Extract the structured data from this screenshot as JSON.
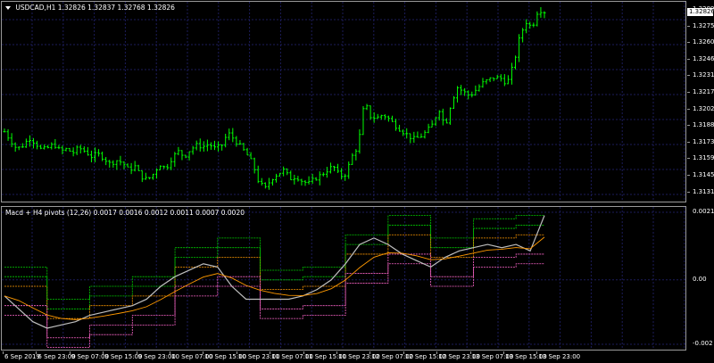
{
  "main_chart": {
    "title": "USDCAD,H1  1.32826 1.32837 1.32768 1.32826",
    "current_price": "1.32826",
    "price_labels": [
      "1.32895",
      "1.32750",
      "1.32605",
      "1.32460",
      "1.32315",
      "1.32170",
      "1.32025",
      "1.31880",
      "1.31735",
      "1.31590",
      "1.31450",
      "1.31310"
    ]
  },
  "indicator": {
    "title": "Macd + H4 pivots (12,26) 0.0017 0.0016 0.0012 0.0011 0.0007 0.0020",
    "scale_labels": [
      "0.0021",
      "0.00",
      "-0.002"
    ]
  },
  "time_axis": {
    "labels": [
      "6 Sep 2019",
      "6 Sep 23:00",
      "9 Sep 07:00",
      "9 Sep 15:00",
      "9 Sep 23:00",
      "10 Sep 07:00",
      "10 Sep 15:00",
      "10 Sep 23:00",
      "11 Sep 07:00",
      "11 Sep 15:00",
      "11 Sep 23:00",
      "12 Sep 07:00",
      "12 Sep 15:00",
      "12 Sep 23:00",
      "13 Sep 07:00",
      "13 Sep 15:00",
      "13 Sep 23:00"
    ]
  },
  "colors": {
    "background": "#000000",
    "candle": "#00ff00",
    "grid": "#1c1c5a",
    "macd_line": "#bebebe",
    "pivot_green": "#00cc00",
    "pivot_pink": "#ff66cc",
    "pivot_orange": "#ff9900",
    "pivot_white": "#ffffff"
  },
  "chart_data": {
    "type": "candlestick",
    "close_series": [
      1.3186,
      1.3179,
      1.3172,
      1.3175,
      1.3181,
      1.3177,
      1.3171,
      1.3173,
      1.3176,
      1.317,
      1.3172,
      1.3169,
      1.3173,
      1.317,
      1.3166,
      1.3168,
      1.3165,
      1.316,
      1.3163,
      1.3161,
      1.3155,
      1.3158,
      1.315,
      1.3147,
      1.3152,
      1.316,
      1.3156,
      1.3165,
      1.317,
      1.3166,
      1.3172,
      1.3175,
      1.3174,
      1.3176,
      1.3172,
      1.3175,
      1.3185,
      1.318,
      1.3174,
      1.3168,
      1.316,
      1.3145,
      1.314,
      1.3148,
      1.3152,
      1.3155,
      1.3148,
      1.315,
      1.3146,
      1.3144,
      1.3148,
      1.3151,
      1.3155,
      1.3158,
      1.315,
      1.3152,
      1.3166,
      1.3175,
      1.321,
      1.3198,
      1.3197,
      1.32,
      1.3196,
      1.3191,
      1.3187,
      1.3183,
      1.318,
      1.3182,
      1.3186,
      1.3192,
      1.3205,
      1.319,
      1.321,
      1.3222,
      1.3218,
      1.3215,
      1.322,
      1.3225,
      1.3228,
      1.323,
      1.3229,
      1.3225,
      1.324,
      1.3262,
      1.3275,
      1.327,
      1.3285,
      1.3283
    ],
    "macd_values": [
      -0.0005,
      -0.0009,
      -0.0013,
      -0.0015,
      -0.0014,
      -0.0013,
      -0.0011,
      -0.001,
      -0.0009,
      -0.0008,
      -0.0006,
      -0.0002,
      0.0001,
      0.0003,
      0.0005,
      0.0004,
      -0.0002,
      -0.0006,
      -0.0006,
      -0.0006,
      -0.0006,
      -0.0005,
      -0.0003,
      0.0,
      0.0005,
      0.0011,
      0.0013,
      0.0011,
      0.0008,
      0.0006,
      0.0004,
      0.0007,
      0.0009,
      0.001,
      0.0011,
      0.001,
      0.0011,
      0.0009,
      0.002
    ],
    "ylim_main": [
      1.3131,
      1.32895
    ],
    "ylim_indicator": [
      -0.002,
      0.0021
    ]
  }
}
